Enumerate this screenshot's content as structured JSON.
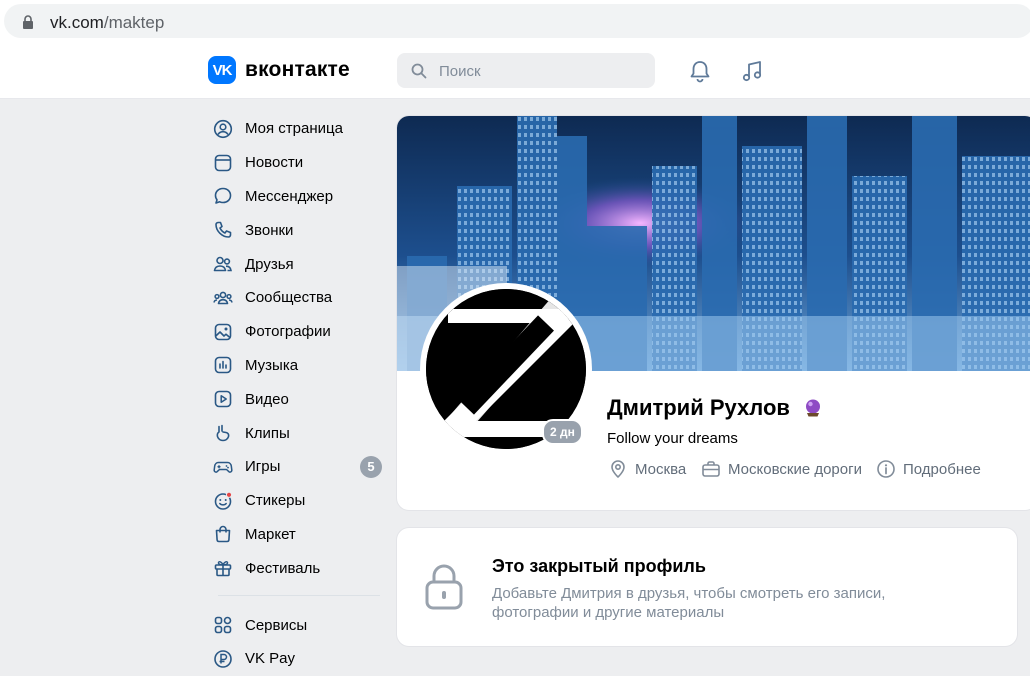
{
  "browser": {
    "url_host": "vk.com",
    "url_path": "/maktep"
  },
  "header": {
    "logo_mark": "VK",
    "logo_text": "вконтакте",
    "search_placeholder": "Поиск",
    "icons": [
      "bell-icon",
      "music-icon"
    ]
  },
  "sidebar": {
    "items": [
      {
        "label": "Моя страница",
        "icon": "user-circle-icon"
      },
      {
        "label": "Новости",
        "icon": "newsfeed-icon"
      },
      {
        "label": "Мессенджер",
        "icon": "message-icon"
      },
      {
        "label": "Звонки",
        "icon": "phone-icon"
      },
      {
        "label": "Друзья",
        "icon": "friends-icon"
      },
      {
        "label": "Сообщества",
        "icon": "communities-icon"
      },
      {
        "label": "Фотографии",
        "icon": "photo-icon"
      },
      {
        "label": "Музыка",
        "icon": "music-playlist-icon"
      },
      {
        "label": "Видео",
        "icon": "video-icon"
      },
      {
        "label": "Клипы",
        "icon": "clips-icon"
      },
      {
        "label": "Игры",
        "icon": "gamepad-icon",
        "badge": "5"
      },
      {
        "label": "Стикеры",
        "icon": "sticker-icon"
      },
      {
        "label": "Маркет",
        "icon": "market-bag-icon"
      },
      {
        "label": "Фестиваль",
        "icon": "gift-icon"
      }
    ],
    "bottom_items": [
      {
        "label": "Сервисы",
        "icon": "services-icon"
      },
      {
        "label": "VK Pay",
        "icon": "vkpay-icon"
      }
    ]
  },
  "profile": {
    "name": "Дмитрий Рухлов",
    "status": "Follow your dreams",
    "online_badge": "2 дн",
    "city": "Москва",
    "work": "Московские дороги",
    "more": "Подробнее"
  },
  "closed_profile": {
    "title": "Это закрытый профиль",
    "description": "Добавьте Дмитрия в друзья, чтобы смотреть его записи, фотографии и другие материалы"
  },
  "colors": {
    "accent": "#0077ff",
    "icon_blue": "#2a5885",
    "page_bg": "#edeef0"
  }
}
